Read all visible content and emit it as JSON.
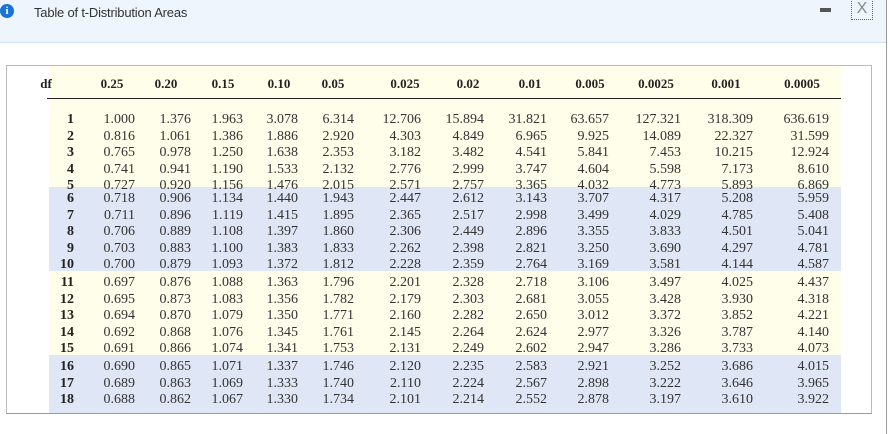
{
  "window": {
    "title": "Table of t-Distribution Areas",
    "info_icon": "i",
    "close_icon": "X"
  },
  "colors": {
    "yellow": "#fffeea",
    "blue": "#dfe6f5"
  },
  "table": {
    "headers": [
      "df",
      "0.25",
      "0.20",
      "0.15",
      "0.10",
      "0.05",
      "0.025",
      "0.02",
      "0.01",
      "0.005",
      "0.0025",
      "0.001",
      "0.0005"
    ],
    "rows": [
      [
        "1",
        "1.000",
        "1.376",
        "1.963",
        "3.078",
        "6.314",
        "12.706",
        "15.894",
        "31.821",
        "63.657",
        "127.321",
        "318.309",
        "636.619"
      ],
      [
        "2",
        "0.816",
        "1.061",
        "1.386",
        "1.886",
        "2.920",
        "4.303",
        "4.849",
        "6.965",
        "9.925",
        "14.089",
        "22.327",
        "31.599"
      ],
      [
        "3",
        "0.765",
        "0.978",
        "1.250",
        "1.638",
        "2.353",
        "3.182",
        "3.482",
        "4.541",
        "5.841",
        "7.453",
        "10.215",
        "12.924"
      ],
      [
        "4",
        "0.741",
        "0.941",
        "1.190",
        "1.533",
        "2.132",
        "2.776",
        "2.999",
        "3.747",
        "4.604",
        "5.598",
        "7.173",
        "8.610"
      ],
      [
        "5",
        "0.727",
        "0.920",
        "1.156",
        "1.476",
        "2.015",
        "2.571",
        "2.757",
        "3.365",
        "4.032",
        "4.773",
        "5.893",
        "6.869"
      ],
      [
        "6",
        "0.718",
        "0.906",
        "1.134",
        "1.440",
        "1.943",
        "2.447",
        "2.612",
        "3.143",
        "3.707",
        "4.317",
        "5.208",
        "5.959"
      ],
      [
        "7",
        "0.711",
        "0.896",
        "1.119",
        "1.415",
        "1.895",
        "2.365",
        "2.517",
        "2.998",
        "3.499",
        "4.029",
        "4.785",
        "5.408"
      ],
      [
        "8",
        "0.706",
        "0.889",
        "1.108",
        "1.397",
        "1.860",
        "2.306",
        "2.449",
        "2.896",
        "3.355",
        "3.833",
        "4.501",
        "5.041"
      ],
      [
        "9",
        "0.703",
        "0.883",
        "1.100",
        "1.383",
        "1.833",
        "2.262",
        "2.398",
        "2.821",
        "3.250",
        "3.690",
        "4.297",
        "4.781"
      ],
      [
        "10",
        "0.700",
        "0.879",
        "1.093",
        "1.372",
        "1.812",
        "2.228",
        "2.359",
        "2.764",
        "3.169",
        "3.581",
        "4.144",
        "4.587"
      ],
      [
        "11",
        "0.697",
        "0.876",
        "1.088",
        "1.363",
        "1.796",
        "2.201",
        "2.328",
        "2.718",
        "3.106",
        "3.497",
        "4.025",
        "4.437"
      ],
      [
        "12",
        "0.695",
        "0.873",
        "1.083",
        "1.356",
        "1.782",
        "2.179",
        "2.303",
        "2.681",
        "3.055",
        "3.428",
        "3.930",
        "4.318"
      ],
      [
        "13",
        "0.694",
        "0.870",
        "1.079",
        "1.350",
        "1.771",
        "2.160",
        "2.282",
        "2.650",
        "3.012",
        "3.372",
        "3.852",
        "4.221"
      ],
      [
        "14",
        "0.692",
        "0.868",
        "1.076",
        "1.345",
        "1.761",
        "2.145",
        "2.264",
        "2.624",
        "2.977",
        "3.326",
        "3.787",
        "4.140"
      ],
      [
        "15",
        "0.691",
        "0.866",
        "1.074",
        "1.341",
        "1.753",
        "2.131",
        "2.249",
        "2.602",
        "2.947",
        "3.286",
        "3.733",
        "4.073"
      ],
      [
        "16",
        "0.690",
        "0.865",
        "1.071",
        "1.337",
        "1.746",
        "2.120",
        "2.235",
        "2.583",
        "2.921",
        "3.252",
        "3.686",
        "4.015"
      ],
      [
        "17",
        "0.689",
        "0.863",
        "1.069",
        "1.333",
        "1.740",
        "2.110",
        "2.224",
        "2.567",
        "2.898",
        "3.222",
        "3.646",
        "3.965"
      ],
      [
        "18",
        "0.688",
        "0.862",
        "1.067",
        "1.330",
        "1.734",
        "2.101",
        "2.214",
        "2.552",
        "2.878",
        "3.197",
        "3.610",
        "3.922"
      ]
    ]
  }
}
